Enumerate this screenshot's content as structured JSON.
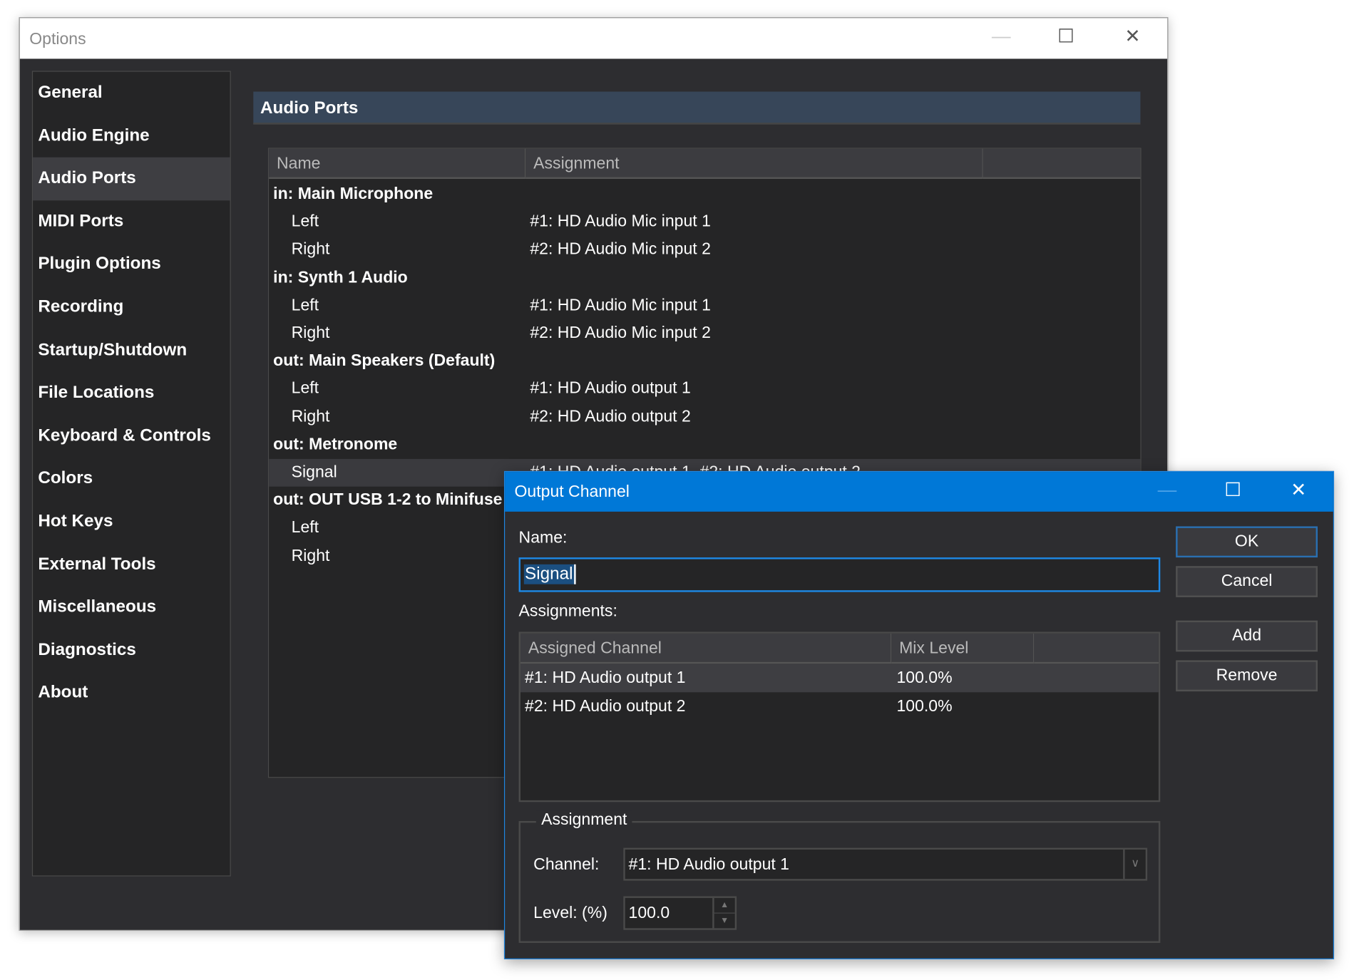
{
  "options_window": {
    "title": "Options",
    "controls": {
      "minimize": "—",
      "maximize": "☐",
      "close": "✕"
    },
    "sidebar": {
      "items": [
        {
          "label": "General"
        },
        {
          "label": "Audio Engine"
        },
        {
          "label": "Audio Ports",
          "selected": true
        },
        {
          "label": "MIDI Ports"
        },
        {
          "label": "Plugin Options"
        },
        {
          "label": "Recording"
        },
        {
          "label": "Startup/Shutdown"
        },
        {
          "label": "File Locations"
        },
        {
          "label": "Keyboard & Controls"
        },
        {
          "label": "Colors"
        },
        {
          "label": "Hot Keys"
        },
        {
          "label": "External Tools"
        },
        {
          "label": "Miscellaneous"
        },
        {
          "label": "Diagnostics"
        },
        {
          "label": "About"
        }
      ]
    },
    "section_title": "Audio Ports",
    "table": {
      "columns": [
        "Name",
        "Assignment",
        ""
      ],
      "rows": [
        {
          "name": "in: Main Microphone",
          "assignment": "",
          "group": true
        },
        {
          "name": "Left",
          "assignment": "#1: HD Audio Mic input 1"
        },
        {
          "name": "Right",
          "assignment": "#2: HD Audio Mic input 2"
        },
        {
          "name": "in: Synth 1 Audio",
          "assignment": "",
          "group": true
        },
        {
          "name": "Left",
          "assignment": "#1: HD Audio Mic input 1"
        },
        {
          "name": "Right",
          "assignment": "#2: HD Audio Mic input 2"
        },
        {
          "name": "out: Main Speakers (Default)",
          "assignment": "",
          "group": true
        },
        {
          "name": "Left",
          "assignment": "#1: HD Audio output 1"
        },
        {
          "name": "Right",
          "assignment": "#2: HD Audio output 2"
        },
        {
          "name": "out: Metronome",
          "assignment": "",
          "group": true
        },
        {
          "name": "Signal",
          "assignment": "#1: HD Audio output 1, #2: HD Audio output 2",
          "selected": true
        },
        {
          "name": "out: OUT USB 1-2 to Minifuse",
          "assignment": "",
          "group": true
        },
        {
          "name": "Left",
          "assignment": ""
        },
        {
          "name": "Right",
          "assignment": ""
        }
      ]
    }
  },
  "dialog": {
    "title": "Output Channel",
    "controls": {
      "minimize": "—",
      "maximize": "☐",
      "close": "✕"
    },
    "name_label": "Name:",
    "name_value": "Signal",
    "assignments_label": "Assignments:",
    "buttons": {
      "ok": "OK",
      "cancel": "Cancel",
      "add": "Add",
      "remove": "Remove"
    },
    "assign_table": {
      "columns": [
        "Assigned Channel",
        "Mix Level",
        ""
      ],
      "rows": [
        {
          "channel": "#1: HD Audio output 1",
          "level": "100.0%",
          "selected": true
        },
        {
          "channel": "#2: HD Audio output 2",
          "level": "100.0%"
        }
      ]
    },
    "group_title": "Assignment",
    "channel_label": "Channel:",
    "channel_value": "#1: HD Audio output 1",
    "level_label": "Level: (%)",
    "level_value": "100.0"
  },
  "colors": {
    "accent": "#0078d7",
    "background": "#2d2d30",
    "selection": "#3e3e42",
    "section_header": "#374659"
  }
}
